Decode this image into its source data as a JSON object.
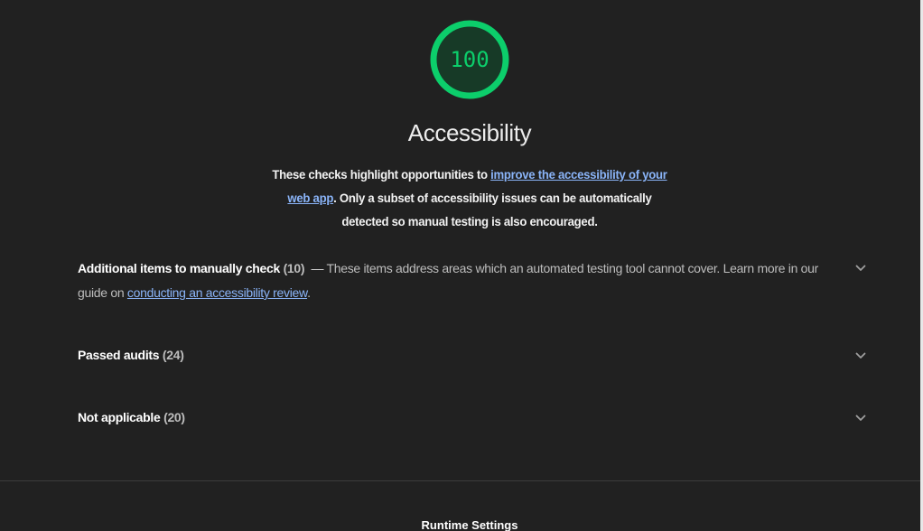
{
  "gauge": {
    "score": "100",
    "fraction": 1.0,
    "color": "#0cce6b",
    "fill": "#173a27"
  },
  "category": {
    "title": "Accessibility",
    "description_prefix": "These checks highlight opportunities to ",
    "description_link": "improve the accessibility of your web app",
    "description_suffix": ". Only a subset of accessibility issues can be automatically detected so manual testing is also encouraged."
  },
  "groups": [
    {
      "title": "Additional items to manually check",
      "count": "(10)",
      "separator": "—",
      "description": "These items address areas which an automated testing tool cannot cover. Learn more in our guide on ",
      "link": "conducting an accessibility review",
      "suffix": "."
    },
    {
      "title": "Passed audits",
      "count": "(24)"
    },
    {
      "title": "Not applicable",
      "count": "(20)"
    }
  ],
  "footer": {
    "title": "Runtime Settings"
  },
  "icons": {
    "expand": "chevron-down-icon"
  },
  "colors": {
    "background": "#212121",
    "link": "#8ab4f8",
    "pass": "#0cce6b"
  }
}
